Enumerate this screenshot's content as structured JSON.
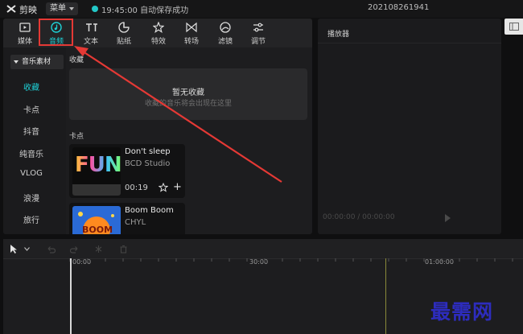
{
  "app": {
    "name": "剪映",
    "menu_label": "菜单",
    "save_status": "19:45:00 自动保存成功",
    "project_name": "202108261941"
  },
  "toolbar": {
    "tabs": [
      {
        "label": "媒体",
        "icon": "media-icon"
      },
      {
        "label": "音频",
        "icon": "audio-icon",
        "active": true
      },
      {
        "label": "文本",
        "icon": "text-icon"
      },
      {
        "label": "贴纸",
        "icon": "sticker-icon"
      },
      {
        "label": "特效",
        "icon": "effects-icon"
      },
      {
        "label": "转场",
        "icon": "transition-icon"
      },
      {
        "label": "滤镜",
        "icon": "filter-icon"
      },
      {
        "label": "调节",
        "icon": "adjust-icon"
      }
    ]
  },
  "sidebar": {
    "header": "音乐素材",
    "items": [
      "收藏",
      "卡点",
      "抖音",
      "纯音乐",
      "VLOG",
      "浪漫",
      "旅行"
    ],
    "active_index": 0
  },
  "favorites": {
    "title": "收藏",
    "empty_title": "暂无收藏",
    "empty_sub": "收藏的音乐将会出现在这里"
  },
  "beats": {
    "title": "卡点",
    "tracks": [
      {
        "title": "Don't sleep",
        "artist": "BCD Studio",
        "duration": "00:19",
        "thumb_text": "FUN"
      },
      {
        "title": "Boom Boom",
        "artist": "CHYL",
        "duration": "",
        "thumb_text": "BOOM"
      }
    ]
  },
  "player": {
    "title": "播放器",
    "time": "00:00:00 / 00:00:00"
  },
  "timeline": {
    "ticks": [
      "00:00",
      "30:00",
      "01:00:00"
    ]
  },
  "watermark": "最需网",
  "colors": {
    "accent": "#1fd0d6",
    "highlight_box": "#e53935",
    "arrow": "#e53935",
    "watermark": "#2d2cbd"
  }
}
